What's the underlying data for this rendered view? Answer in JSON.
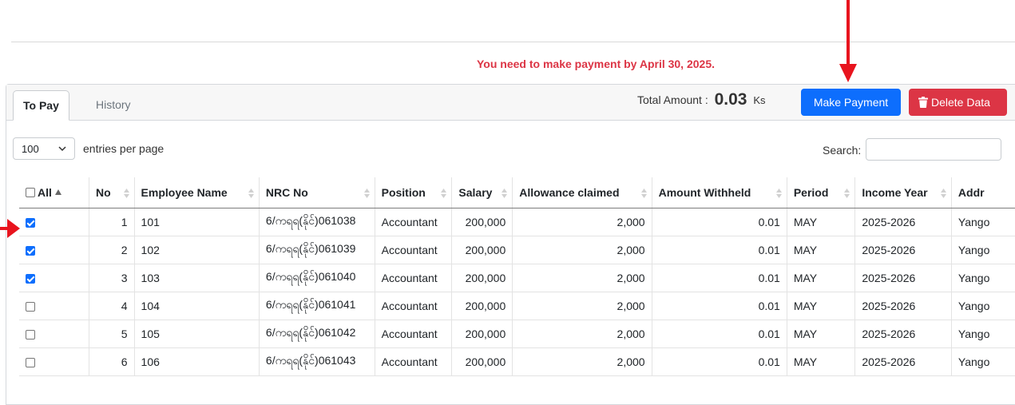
{
  "notice": "You need to make payment by April 30, 2025.",
  "tabs": {
    "to_pay": "To Pay",
    "history": "History"
  },
  "total": {
    "label": "Total Amount :",
    "amount": "0.03",
    "currency": "Ks"
  },
  "buttons": {
    "make_payment": "Make Payment",
    "delete_data": "Delete Data"
  },
  "length_menu": {
    "value": "100",
    "label": "entries per page"
  },
  "search": {
    "label": "Search:",
    "value": ""
  },
  "table": {
    "columns": [
      "All",
      "No",
      "Employee Name",
      "NRC No",
      "Position",
      "Salary",
      "Allowance claimed",
      "Amount Withheld",
      "Period",
      "Income Year",
      "Addr"
    ],
    "rows": [
      {
        "checked": true,
        "no": "1",
        "name": "101",
        "nrc": "6/ကရရ(နိုင်)061038",
        "position": "Accountant",
        "salary": "200,000",
        "allowance": "2,000",
        "withheld": "0.01",
        "period": "MAY",
        "year": "2025-2026",
        "address": "Yango"
      },
      {
        "checked": true,
        "no": "2",
        "name": "102",
        "nrc": "6/ကရရ(နိုင်)061039",
        "position": "Accountant",
        "salary": "200,000",
        "allowance": "2,000",
        "withheld": "0.01",
        "period": "MAY",
        "year": "2025-2026",
        "address": "Yango"
      },
      {
        "checked": true,
        "no": "3",
        "name": "103",
        "nrc": "6/ကရရ(နိုင်)061040",
        "position": "Accountant",
        "salary": "200,000",
        "allowance": "2,000",
        "withheld": "0.01",
        "period": "MAY",
        "year": "2025-2026",
        "address": "Yango"
      },
      {
        "checked": false,
        "no": "4",
        "name": "104",
        "nrc": "6/ကရရ(နိုင်)061041",
        "position": "Accountant",
        "salary": "200,000",
        "allowance": "2,000",
        "withheld": "0.01",
        "period": "MAY",
        "year": "2025-2026",
        "address": "Yango"
      },
      {
        "checked": false,
        "no": "5",
        "name": "105",
        "nrc": "6/ကရရ(နိုင်)061042",
        "position": "Accountant",
        "salary": "200,000",
        "allowance": "2,000",
        "withheld": "0.01",
        "period": "MAY",
        "year": "2025-2026",
        "address": "Yango"
      },
      {
        "checked": false,
        "no": "6",
        "name": "106",
        "nrc": "6/ကရရ(နိုင်)061043",
        "position": "Accountant",
        "salary": "200,000",
        "allowance": "2,000",
        "withheld": "0.01",
        "period": "MAY",
        "year": "2025-2026",
        "address": "Yango"
      }
    ]
  },
  "colors": {
    "primary": "#0d6efd",
    "danger": "#dc3545",
    "annotation_arrow": "#e8141e"
  },
  "icons": {
    "delete": "trash-icon",
    "select": "chevron-down-icon",
    "sort": "sort-arrows-icon"
  }
}
